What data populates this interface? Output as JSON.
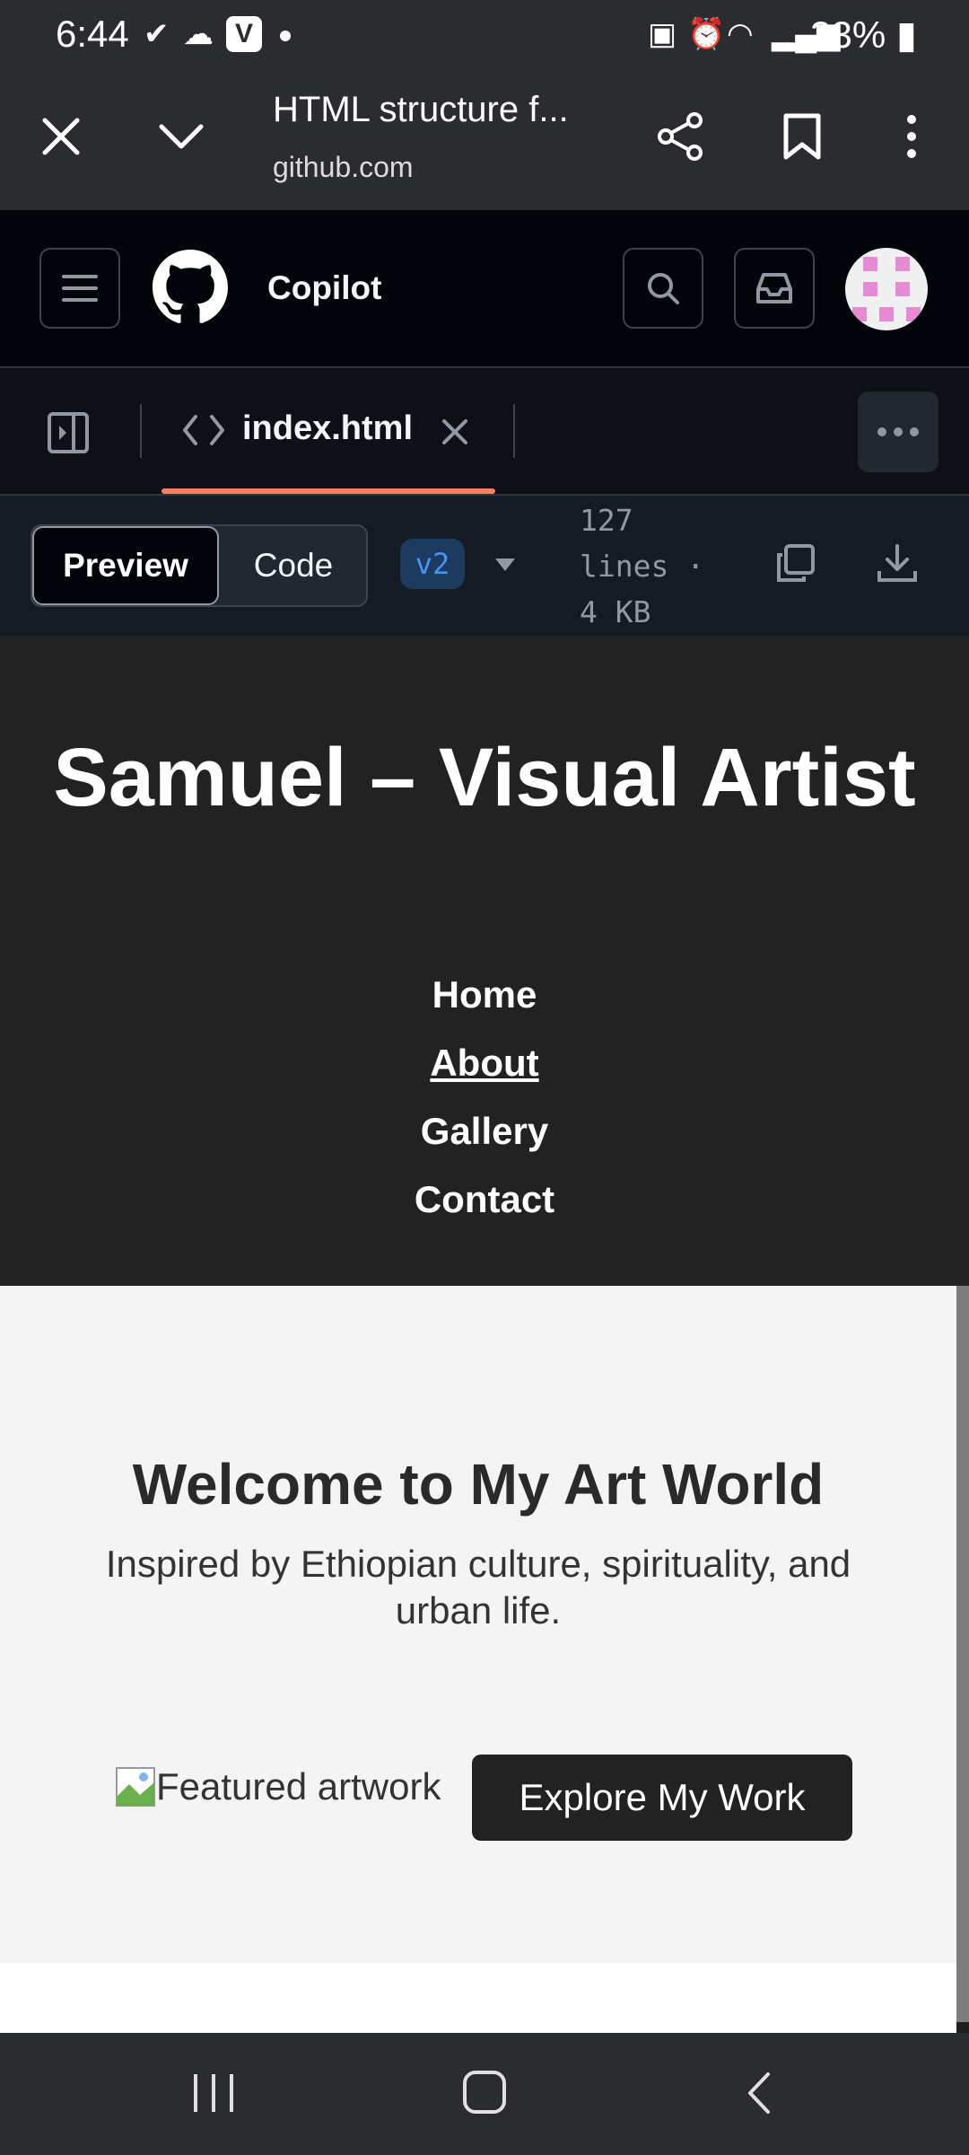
{
  "status_bar": {
    "time": "6:44",
    "battery": "33%"
  },
  "browser": {
    "tab_title": "HTML structure f...",
    "url": "github.com"
  },
  "github": {
    "context": "Copilot"
  },
  "file_tab": {
    "name": "index.html"
  },
  "toolbar": {
    "preview_label": "Preview",
    "code_label": "Code",
    "version": "v2",
    "lines_line1": "127",
    "lines_line2": "lines ·",
    "size": "4 KB"
  },
  "site": {
    "title": "Samuel – Visual Artist",
    "nav": [
      "Home",
      "About",
      "Gallery",
      "Contact"
    ],
    "hero_heading": "Welcome to My Art World",
    "hero_text": "Inspired by Ethiopian culture, spirituality, and urban life.",
    "image_alt": "Featured artwork",
    "cta_label": "Explore My Work"
  },
  "colors": {
    "tab_underline": "#f78166",
    "version_badge": "#4493f8",
    "avatar": "#e68ad3"
  }
}
